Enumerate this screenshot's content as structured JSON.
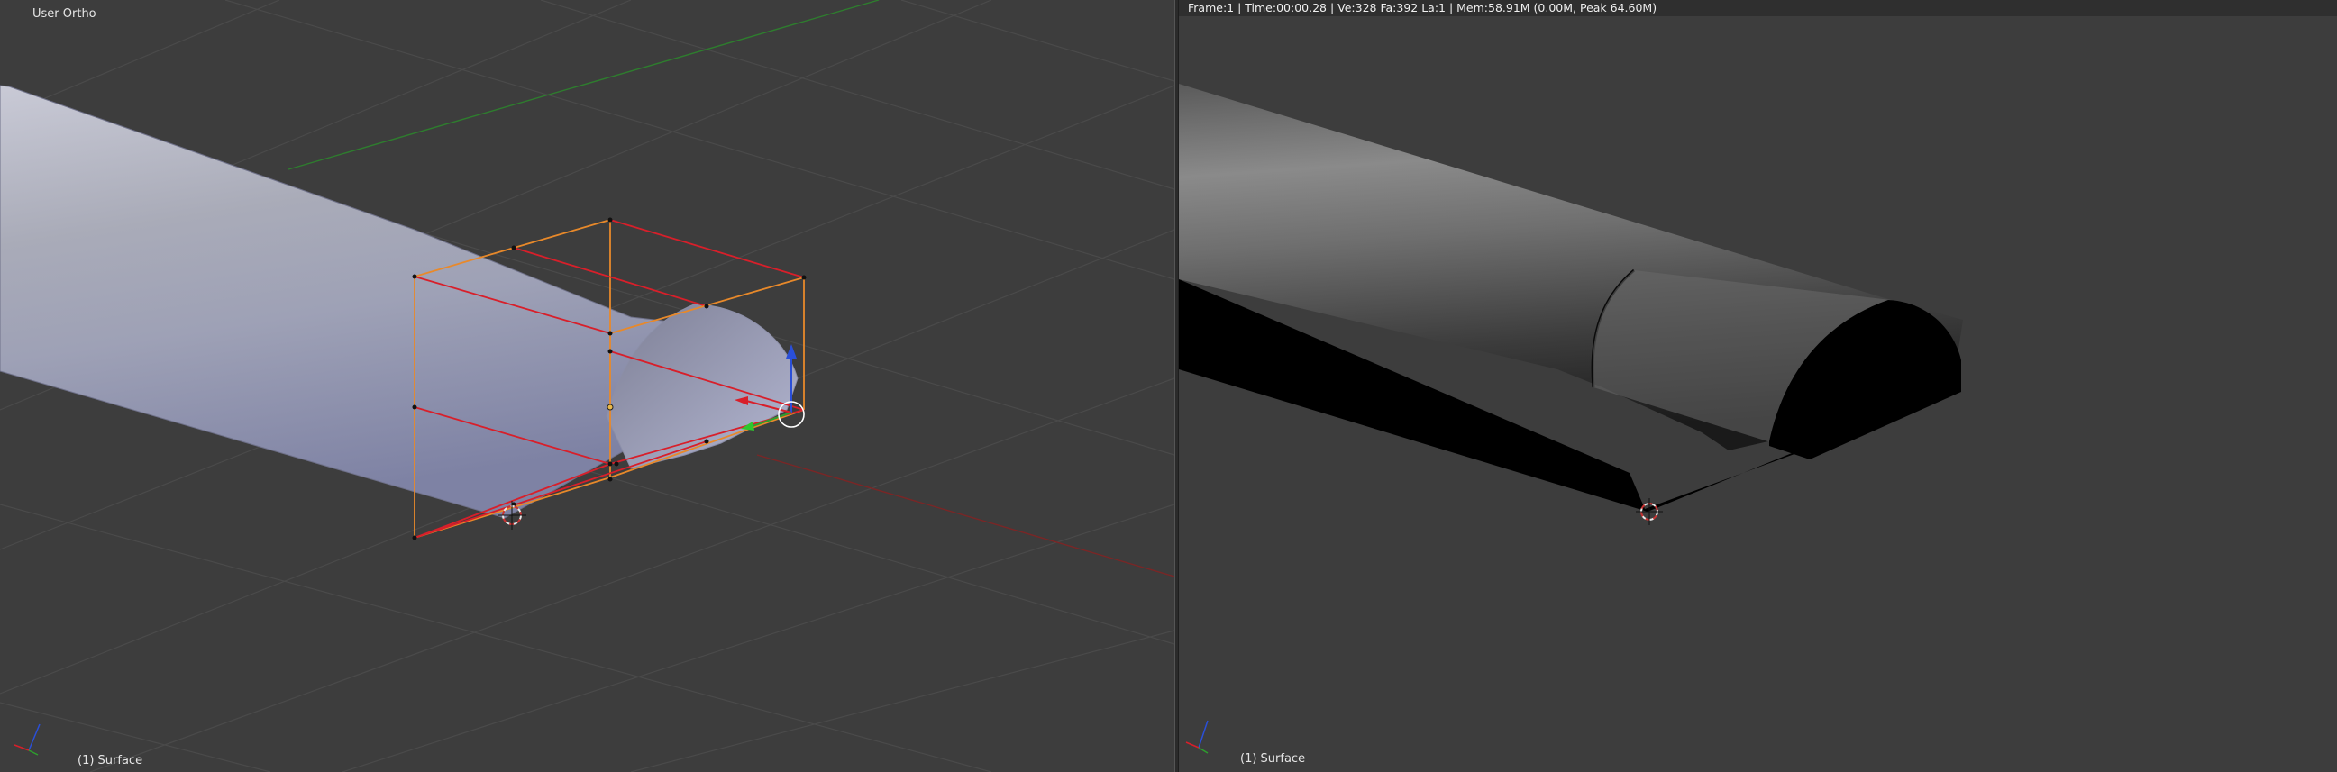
{
  "left_viewport": {
    "view_label": "User Ortho",
    "object_label": "(1) Surface"
  },
  "right_viewport": {
    "info_bar": "Frame:1 | Time:00:00.28 | Ve:328 Fa:392 La:1 | Mem:58.91M (0.00M, Peak 64.60M)",
    "object_label": "(1) Surface"
  },
  "colors": {
    "background": "#3d3d3d",
    "grid": "#4a4a4a",
    "x_axis": "#8a2a2a",
    "y_axis": "#2e7d2e",
    "selection_orange": "#e8892a",
    "control_red": "#d81f2a"
  },
  "icons": [
    "3d-cursor-icon",
    "transform-gizmo-icon",
    "axis-navigation-icon"
  ]
}
